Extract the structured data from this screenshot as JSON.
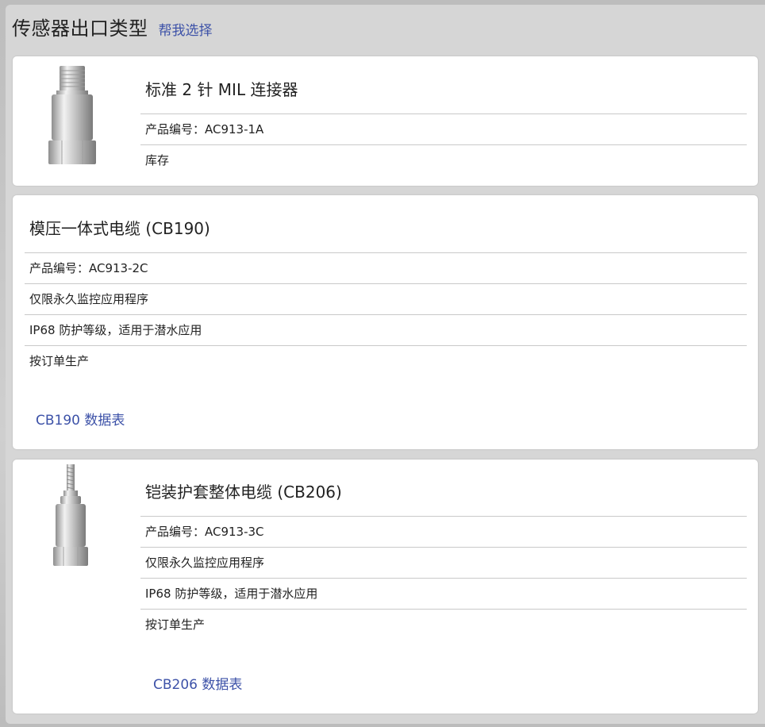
{
  "header": {
    "title": "传感器出口类型",
    "help_link": "帮我选择"
  },
  "cards": [
    {
      "title": "标准 2 针 MIL 连接器",
      "rows": [
        "产品编号：AC913-1A",
        "库存"
      ],
      "image": "sensor-connector-image"
    },
    {
      "title": "模压一体式电缆 (CB190)",
      "rows": [
        "产品编号：AC913-2C",
        "仅限永久监控应用程序",
        "IP68 防护等级，适用于潜水应用",
        "按订单生产"
      ],
      "datasheet_link": "CB190 数据表"
    },
    {
      "title": "铠装护套整体电缆 (CB206)",
      "rows": [
        "产品编号：AC913-3C",
        "仅限永久监控应用程序",
        "IP68 防护等级，适用于潜水应用",
        "按订单生产"
      ],
      "datasheet_link": "CB206 数据表",
      "image": "sensor-armored-cable-image"
    }
  ],
  "colors": {
    "link": "#3d52a8",
    "panel_bg": "#d6d6d6",
    "card_bg": "#ffffff",
    "divider": "#c9c9c9"
  }
}
